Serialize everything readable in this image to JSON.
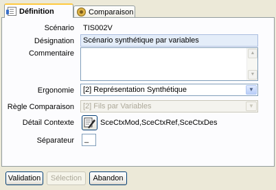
{
  "tabs": [
    {
      "label": "Définition",
      "icon": "document-icon",
      "active": true
    },
    {
      "label": "Comparaison",
      "icon": "comparison-icon",
      "active": false
    }
  ],
  "form": {
    "scenario": {
      "label": "Scénario",
      "value": "TIS002V"
    },
    "designation": {
      "label": "Désignation",
      "value": "Scénario synthétique par variables"
    },
    "commentaire": {
      "label": "Commentaire",
      "value": ""
    },
    "ergonomie": {
      "label": "Ergonomie",
      "value": "[2] Représentation Synthétique"
    },
    "regle": {
      "label": "Règle Comparaison",
      "value": "[2] Fils par Variables"
    },
    "detail": {
      "label": "Détail Contexte",
      "value": "SceCtxMod,SceCtxRef,SceCtxDes"
    },
    "separateur": {
      "label": "Séparateur",
      "value": "_"
    }
  },
  "buttons": {
    "validation": "Validation",
    "selection": "Sélection",
    "abandon": "Abandon"
  },
  "colors": {
    "window_bg": "#ece9d8",
    "panel_bg": "#fcfcfe",
    "active_tab_accent": "#ffc83c",
    "field_border": "#7f9db9"
  }
}
